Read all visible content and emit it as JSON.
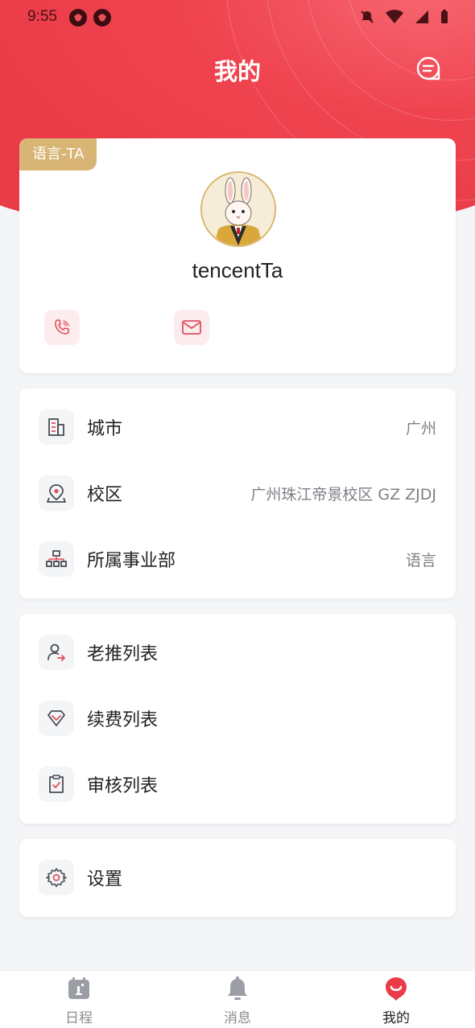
{
  "status_bar": {
    "time": "9:55"
  },
  "header": {
    "title": "我的"
  },
  "profile": {
    "role_tag": "语言-TA",
    "username": "tencentTa"
  },
  "info": {
    "items": [
      {
        "label": "城市",
        "value": "广州",
        "icon": "building-icon"
      },
      {
        "label": "校区",
        "value": "广州珠江帝景校区 GZ ZJDJ",
        "icon": "location-pin-icon"
      },
      {
        "label": "所属事业部",
        "value": "语言",
        "icon": "org-chart-icon"
      }
    ]
  },
  "lists": {
    "items": [
      {
        "label": "老推列表",
        "icon": "user-referral-icon"
      },
      {
        "label": "续费列表",
        "icon": "diamond-icon"
      },
      {
        "label": "审核列表",
        "icon": "clipboard-check-icon"
      }
    ]
  },
  "settings": {
    "label": "设置",
    "icon": "gear-icon"
  },
  "tabbar": {
    "tabs": [
      {
        "label": "日程",
        "icon": "calendar-icon",
        "active": false
      },
      {
        "label": "消息",
        "icon": "bell-icon",
        "active": false
      },
      {
        "label": "我的",
        "icon": "profile-icon",
        "active": true
      }
    ]
  },
  "colors": {
    "brand_red": "#ea3c48",
    "tag_gold": "#d8b575",
    "background": "#f4f5f7"
  }
}
